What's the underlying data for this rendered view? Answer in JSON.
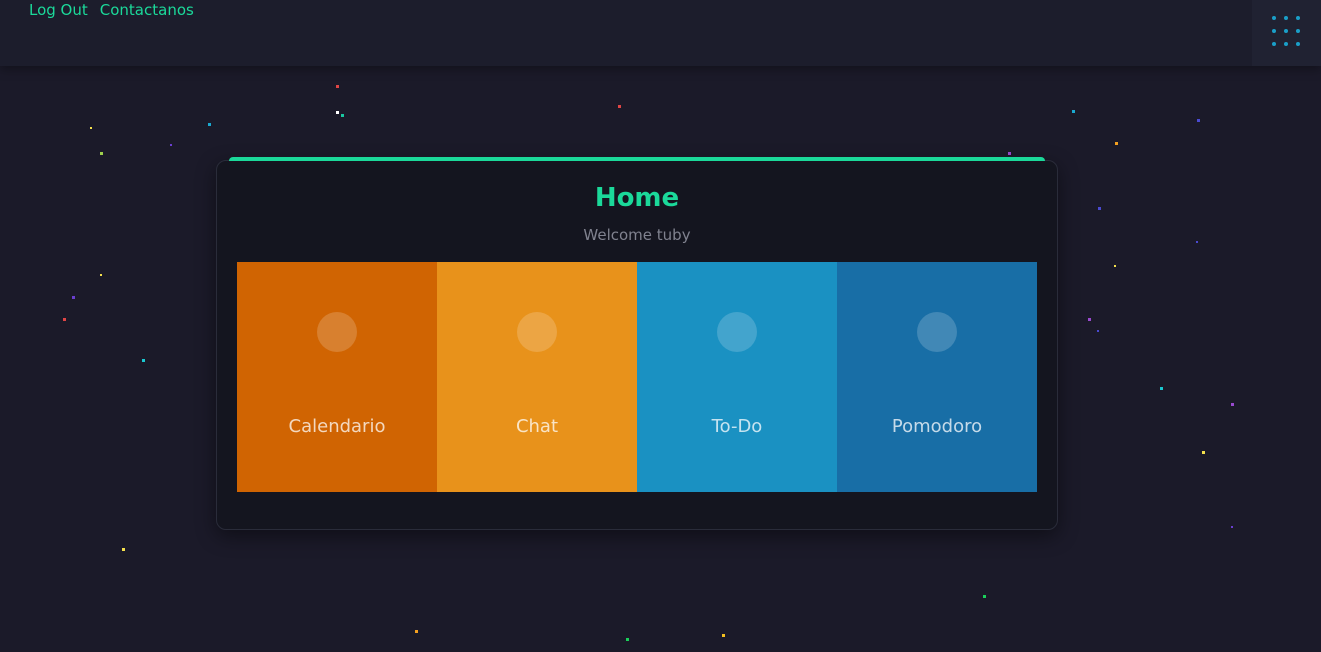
{
  "nav": {
    "links": [
      {
        "label": "Log Out"
      },
      {
        "label": "Contactanos"
      }
    ]
  },
  "menu": {
    "icon": "grid-dots-icon",
    "color": "#1a9fc8"
  },
  "card": {
    "title": "Home",
    "subtitle": "Welcome tuby",
    "accent": "#1bd99a",
    "tiles": [
      {
        "label": "Calendario",
        "color": "#d06402",
        "icon": "circle-icon"
      },
      {
        "label": "Chat",
        "color": "#e8921b",
        "icon": "circle-icon"
      },
      {
        "label": "To-Do",
        "color": "#1a91c2",
        "icon": "circle-icon"
      },
      {
        "label": "Pomodoro",
        "color": "#186ea6",
        "icon": "circle-icon"
      }
    ]
  },
  "colors": {
    "background": "#1b1a29",
    "topbar": "#1c1d2c",
    "card": "#14151f"
  }
}
